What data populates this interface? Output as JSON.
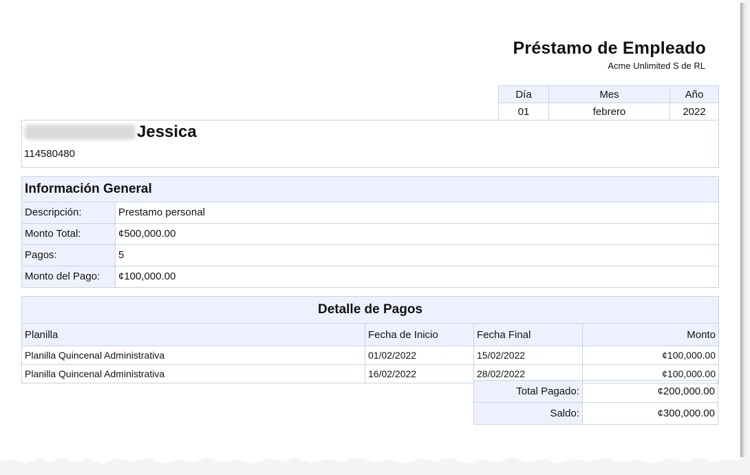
{
  "document": {
    "title": "Préstamo de Empleado",
    "company": "Acme Unlimited S de RL"
  },
  "date": {
    "labels": [
      "Día",
      "Mes",
      "Año"
    ],
    "values": [
      "01",
      "febrero",
      "2022"
    ]
  },
  "employee": {
    "first_name": "Jessica",
    "id_number": "114580480"
  },
  "general_info": {
    "heading": "Información General",
    "rows": [
      {
        "label": "Descripción:",
        "value": "Prestamo personal"
      },
      {
        "label": "Monto Total:",
        "value": "¢500,000.00"
      },
      {
        "label": "Pagos:",
        "value": "5"
      },
      {
        "label": "Monto del Pago:",
        "value": "¢100,000.00"
      }
    ]
  },
  "payments": {
    "heading": "Detalle de Pagos",
    "columns": [
      "Planilla",
      "Fecha de Inicio",
      "Fecha Final",
      "Monto"
    ],
    "rows": [
      [
        "Planilla Quincenal Administrativa",
        "01/02/2022",
        "15/02/2022",
        "¢100,000.00"
      ],
      [
        "Planilla Quincenal Administrativa",
        "16/02/2022",
        "28/02/2022",
        "¢100,000.00"
      ]
    ],
    "totals": [
      {
        "label": "Total Pagado:",
        "value": "¢200,000.00"
      },
      {
        "label": "Saldo:",
        "value": "¢300,000.00"
      }
    ]
  }
}
